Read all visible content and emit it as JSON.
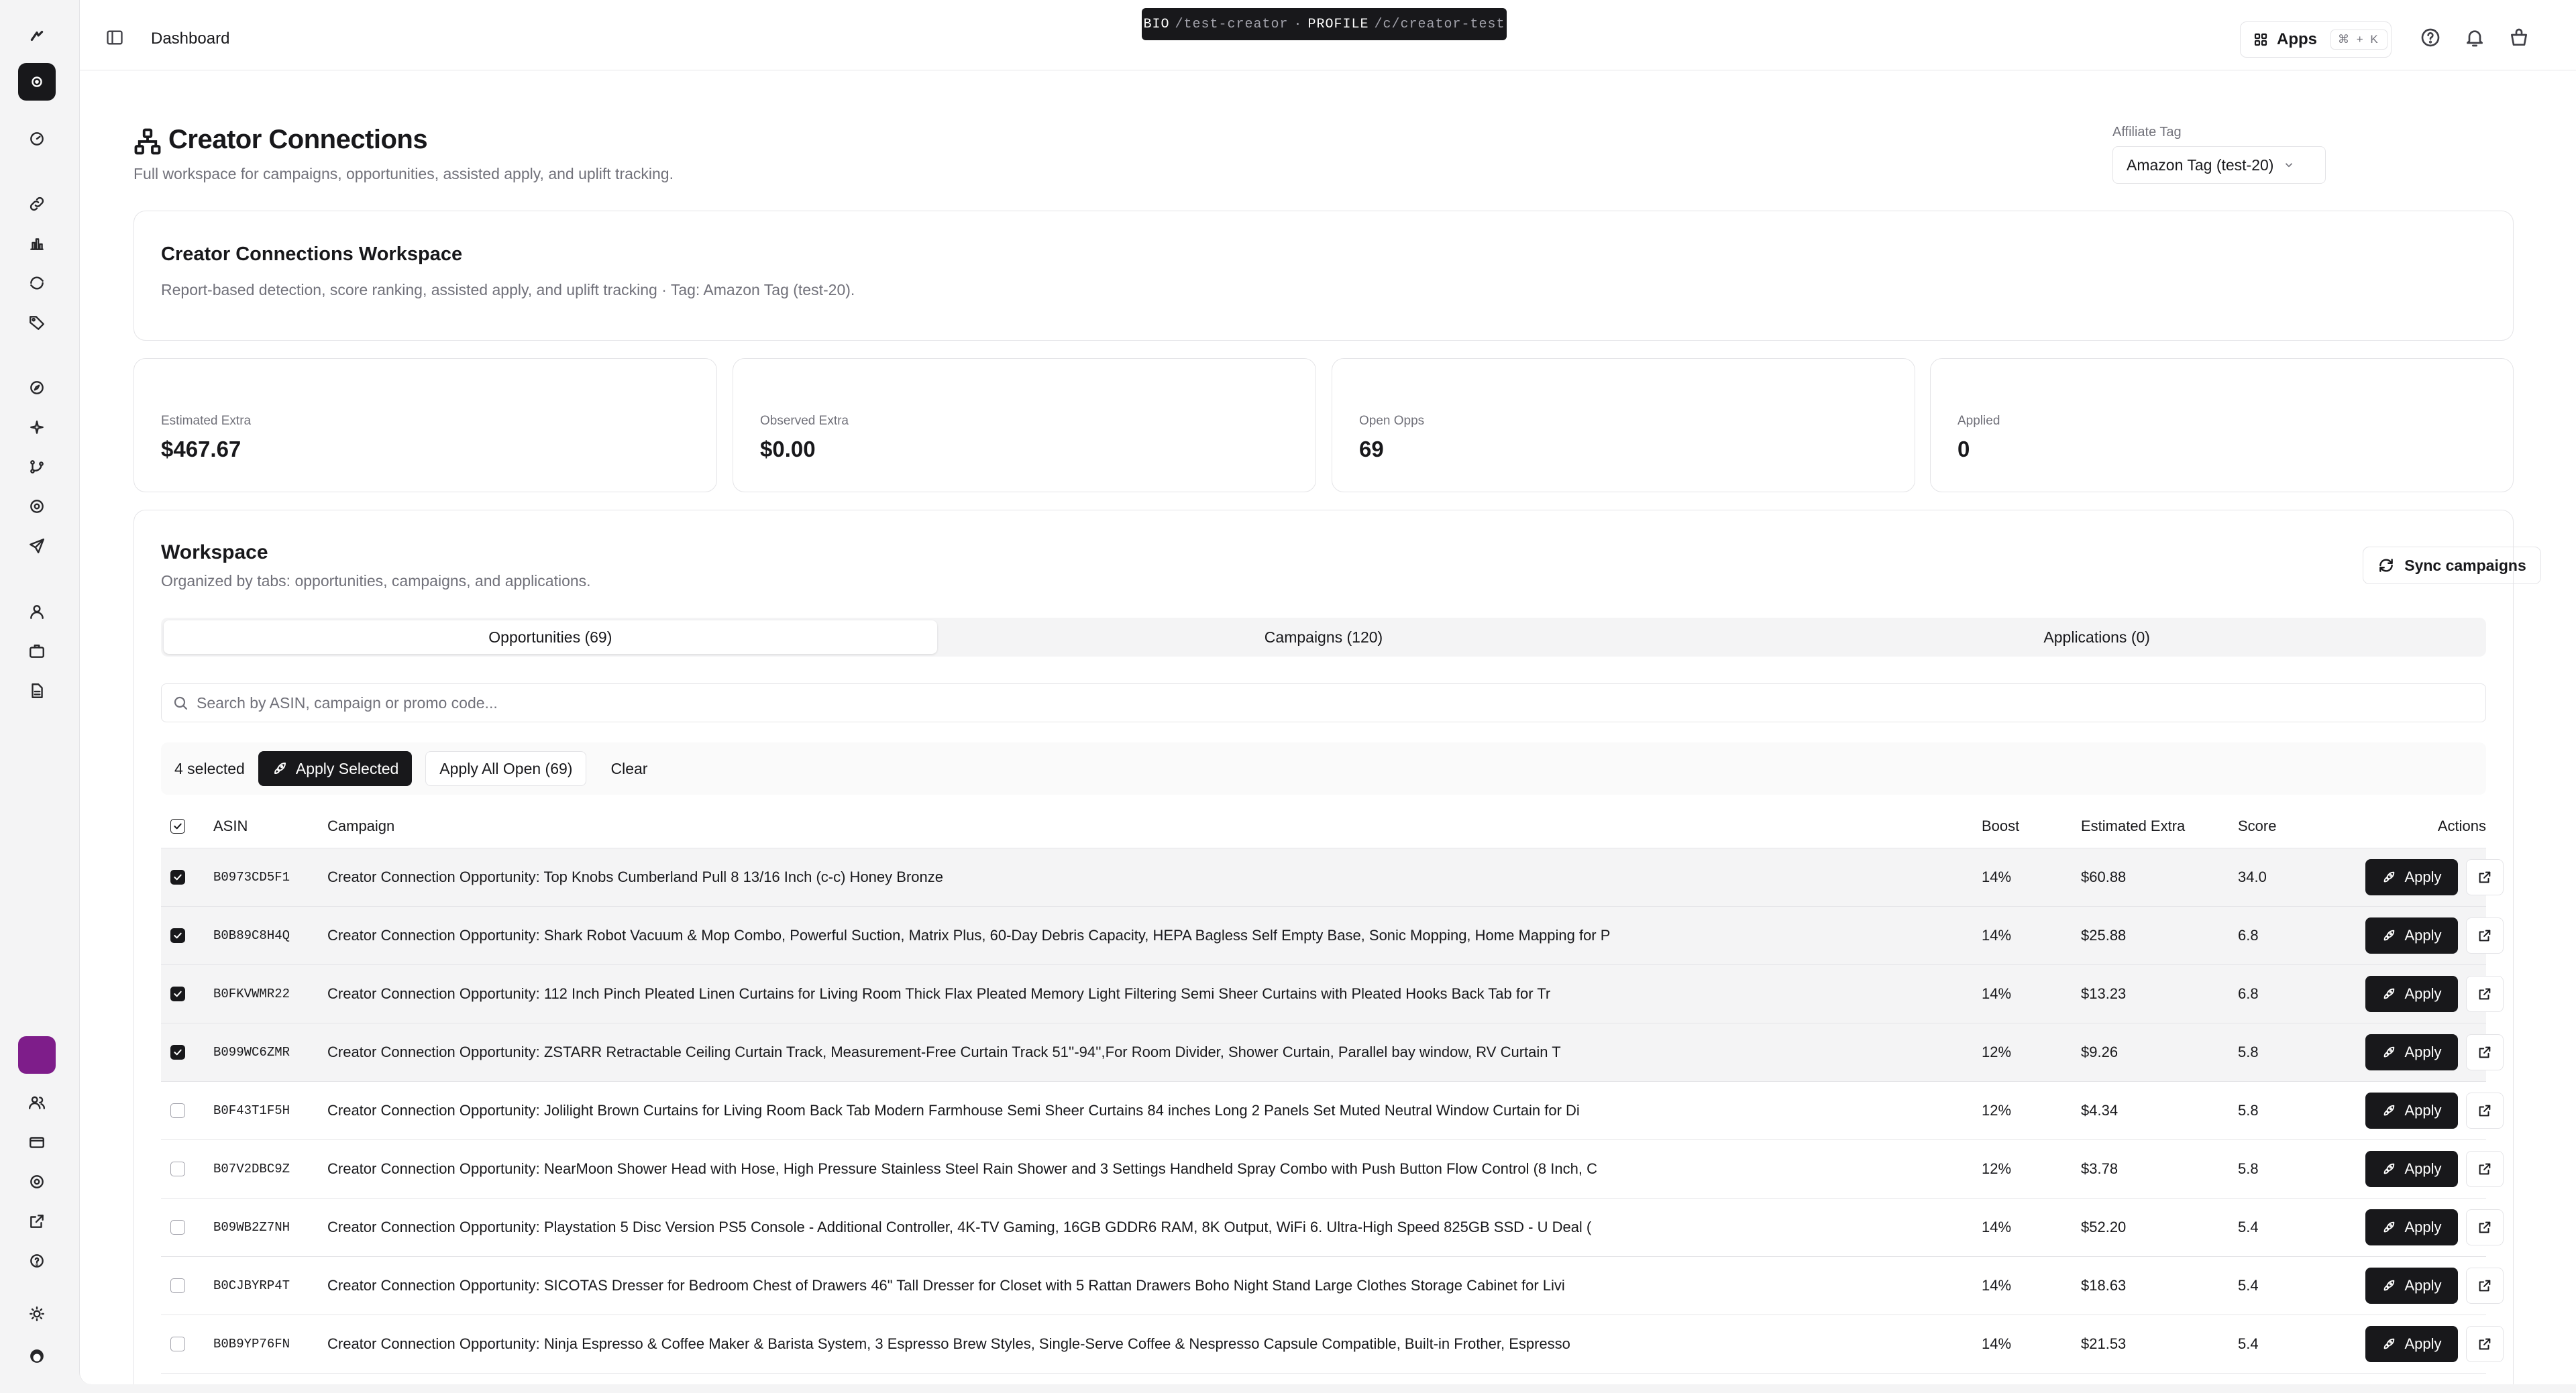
{
  "topbar": {
    "breadcrumb": "Dashboard",
    "bio_label": "BIO",
    "bio_path": "/test-creator",
    "separator": "·",
    "profile_label": "PROFILE",
    "profile_path": "/c/creator-test",
    "apps_label": "Apps",
    "apps_shortcut": "⌘ + K"
  },
  "header": {
    "title": "Creator Connections",
    "subtitle": "Full workspace for campaigns, opportunities, assisted apply, and uplift tracking.",
    "affiliate_label": "Affiliate Tag",
    "affiliate_value": "Amazon Tag (test-20)"
  },
  "workspace_card": {
    "title": "Creator Connections Workspace",
    "subtitle": "Report-based detection, score ranking, assisted apply, and uplift tracking · Tag: Amazon Tag (test-20)."
  },
  "stats": [
    {
      "label": "Estimated Extra",
      "value": "$467.67"
    },
    {
      "label": "Observed Extra",
      "value": "$0.00"
    },
    {
      "label": "Open Opps",
      "value": "69"
    },
    {
      "label": "Applied",
      "value": "0"
    }
  ],
  "workspace": {
    "title": "Workspace",
    "subtitle": "Organized by tabs: opportunities, campaigns, and applications.",
    "sync_label": "Sync campaigns",
    "tabs": [
      {
        "label": "Opportunities (69)"
      },
      {
        "label": "Campaigns (120)"
      },
      {
        "label": "Applications (0)"
      }
    ],
    "search_placeholder": "Search by ASIN, campaign or promo code...",
    "selected_count": "4 selected",
    "apply_selected": "Apply Selected",
    "apply_all_open": "Apply All Open (69)",
    "clear": "Clear"
  },
  "table": {
    "headers": {
      "asin": "ASIN",
      "campaign": "Campaign",
      "boost": "Boost",
      "estimated": "Estimated Extra",
      "score": "Score",
      "actions": "Actions"
    },
    "apply_label": "Apply",
    "rows": [
      {
        "asin": "B0973CD5F1",
        "campaign": "Creator Connection Opportunity: Top Knobs Cumberland Pull 8 13/16 Inch (c-c) Honey Bronze",
        "boost": "14%",
        "estimated": "$60.88",
        "score": "34.0",
        "selected": true
      },
      {
        "asin": "B0B89C8H4Q",
        "campaign": "Creator Connection Opportunity: Shark Robot Vacuum & Mop Combo, Powerful Suction, Matrix Plus, 60-Day Debris Capacity, HEPA Bagless Self Empty Base, Sonic Mopping, Home Mapping for P",
        "boost": "14%",
        "estimated": "$25.88",
        "score": "6.8",
        "selected": true
      },
      {
        "asin": "B0FKVWMR22",
        "campaign": "Creator Connection Opportunity: 112 Inch Pinch Pleated Linen Curtains for Living Room Thick Flax Pleated Memory Light Filtering Semi Sheer Curtains with Pleated Hooks Back Tab for Tr",
        "boost": "14%",
        "estimated": "$13.23",
        "score": "6.8",
        "selected": true
      },
      {
        "asin": "B099WC6ZMR",
        "campaign": "Creator Connection Opportunity: ZSTARR Retractable Ceiling Curtain Track, Measurement-Free Curtain Track 51''-94'',For Room Divider, Shower Curtain, Parallel bay window, RV Curtain T",
        "boost": "12%",
        "estimated": "$9.26",
        "score": "5.8",
        "selected": true
      },
      {
        "asin": "B0F43T1F5H",
        "campaign": "Creator Connection Opportunity: Jolilight Brown Curtains for Living Room Back Tab Modern Farmhouse Semi Sheer Curtains 84 inches Long 2 Panels Set Muted Neutral Window Curtain for Di",
        "boost": "12%",
        "estimated": "$4.34",
        "score": "5.8",
        "selected": false
      },
      {
        "asin": "B07V2DBC9Z",
        "campaign": "Creator Connection Opportunity: NearMoon Shower Head with Hose, High Pressure Stainless Steel Rain Shower and 3 Settings Handheld Spray Combo with Push Button Flow Control (8 Inch, C",
        "boost": "12%",
        "estimated": "$3.78",
        "score": "5.8",
        "selected": false
      },
      {
        "asin": "B09WB2Z7NH",
        "campaign": "Creator Connection Opportunity: Playstation 5 Disc Version PS5 Console - Additional Controller, 4K-TV Gaming, 16GB GDDR6 RAM, 8K Output, WiFi 6. Ultra-High Speed 825GB SSD - U Deal (",
        "boost": "14%",
        "estimated": "$52.20",
        "score": "5.4",
        "selected": false
      },
      {
        "asin": "B0CJBYRP4T",
        "campaign": "Creator Connection Opportunity: SICOTAS Dresser for Bedroom Chest of Drawers 46\" Tall Dresser for Closet with 5 Rattan Drawers Boho Night Stand Large Clothes Storage Cabinet for Livi",
        "boost": "14%",
        "estimated": "$18.63",
        "score": "5.4",
        "selected": false
      },
      {
        "asin": "B0B9YP76FN",
        "campaign": "Creator Connection Opportunity: Ninja Espresso & Coffee Maker & Barista System, 3 Espresso Brew Styles, Single-Serve Coffee & Nespresso Capsule Compatible, Built-in Frother, Espresso",
        "boost": "14%",
        "estimated": "$21.53",
        "score": "5.4",
        "selected": false
      }
    ]
  },
  "colors": {
    "accent": "#18181b",
    "rail_app": "#7e1d8a",
    "muted_text": "#71717a",
    "border": "#e4e4e7"
  }
}
